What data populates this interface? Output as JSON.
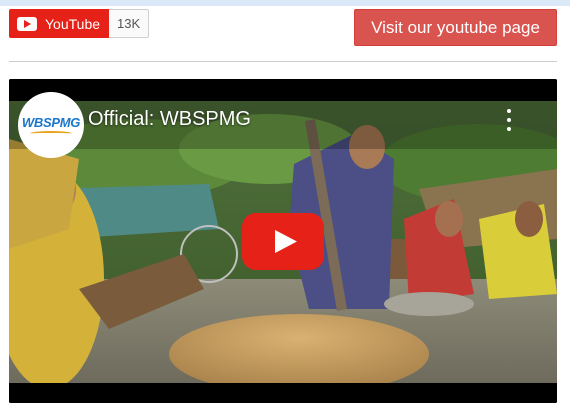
{
  "youtube_button": {
    "label": "YouTube",
    "subscriber_count": "13K",
    "icon": "youtube-play-icon"
  },
  "visit_button": {
    "label": "Visit our youtube page"
  },
  "video": {
    "title": "Official: WBSPMG",
    "channel_logo": {
      "name": "WBSPMG"
    },
    "play_icon": "play-icon",
    "menu_icon": "more-vert-icon"
  },
  "colors": {
    "youtube_red": "#e62117",
    "visit_button_bg": "#d9534f",
    "logo_blue": "#1976c8"
  }
}
